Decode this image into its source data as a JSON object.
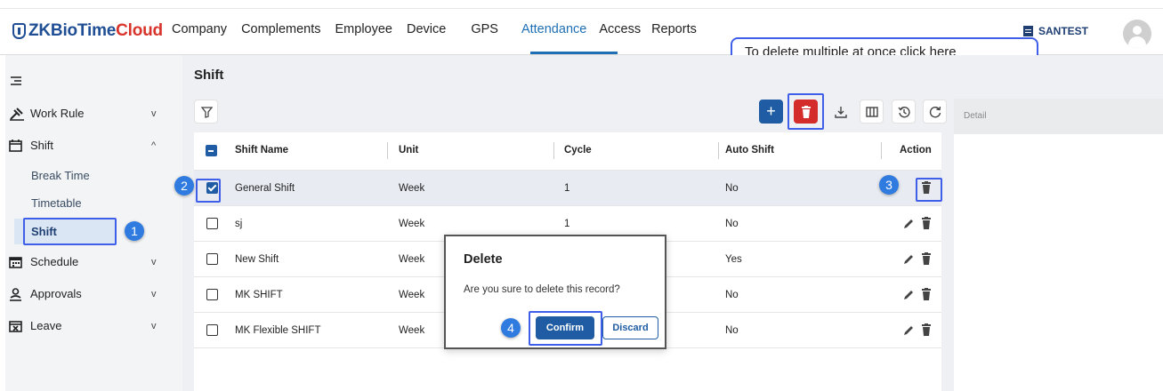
{
  "app": {
    "logo_prefix": "ZKBioTime",
    "logo_suffix": "Cloud"
  },
  "nav": [
    "Company",
    "Complements",
    "Employee",
    "Device",
    "GPS",
    "Attendance",
    "Access",
    "Reports"
  ],
  "nav_active": "Attendance",
  "tenant": "SANTEST",
  "sidebar": {
    "items": [
      {
        "label": "Work Rule",
        "icon": "work-rule-icon",
        "chevron": "v"
      },
      {
        "label": "Shift",
        "icon": "calendar-icon",
        "chevron": "^"
      },
      {
        "label": "Schedule",
        "icon": "schedule-calendar-icon",
        "chevron": "v"
      },
      {
        "label": "Approvals",
        "icon": "person-approval-icon",
        "chevron": "v"
      },
      {
        "label": "Leave",
        "icon": "leave-calendar-icon",
        "chevron": "v"
      }
    ],
    "sub_items": [
      "Break Time",
      "Timetable",
      "Shift"
    ],
    "active_sub": "Shift"
  },
  "page": {
    "title": "Shift"
  },
  "toolbar": [
    "filter-icon",
    "add-icon",
    "delete-icon",
    "export-icon",
    "columns-icon",
    "history-icon",
    "refresh-icon"
  ],
  "table": {
    "columns": [
      "Shift Name",
      "Unit",
      "Cycle",
      "Auto Shift",
      "Action"
    ],
    "rows": [
      {
        "name": "General Shift",
        "unit": "Week",
        "cycle": "1",
        "auto": "No",
        "checked": true
      },
      {
        "name": "sj",
        "unit": "Week",
        "cycle": "1",
        "auto": "No",
        "checked": false
      },
      {
        "name": "New Shift",
        "unit": "Week",
        "cycle": "",
        "auto": "Yes",
        "checked": false
      },
      {
        "name": "MK SHIFT",
        "unit": "Week",
        "cycle": "",
        "auto": "No",
        "checked": false
      },
      {
        "name": "MK Flexible SHIFT",
        "unit": "Week",
        "cycle": "",
        "auto": "No",
        "checked": false
      }
    ]
  },
  "detail": {
    "header": "Detail"
  },
  "dialog": {
    "title": "Delete",
    "message": "Are you sure to delete this record?",
    "confirm": "Confirm",
    "discard": "Discard"
  },
  "annotations": {
    "callout": "To delete multiple at once click here",
    "steps": [
      "1",
      "2",
      "3",
      "4"
    ]
  },
  "colors": {
    "primary": "#1f5ca3",
    "danger": "#d42b2b",
    "highlight": "#3f5fe8",
    "step_badge": "#2f7be0"
  }
}
